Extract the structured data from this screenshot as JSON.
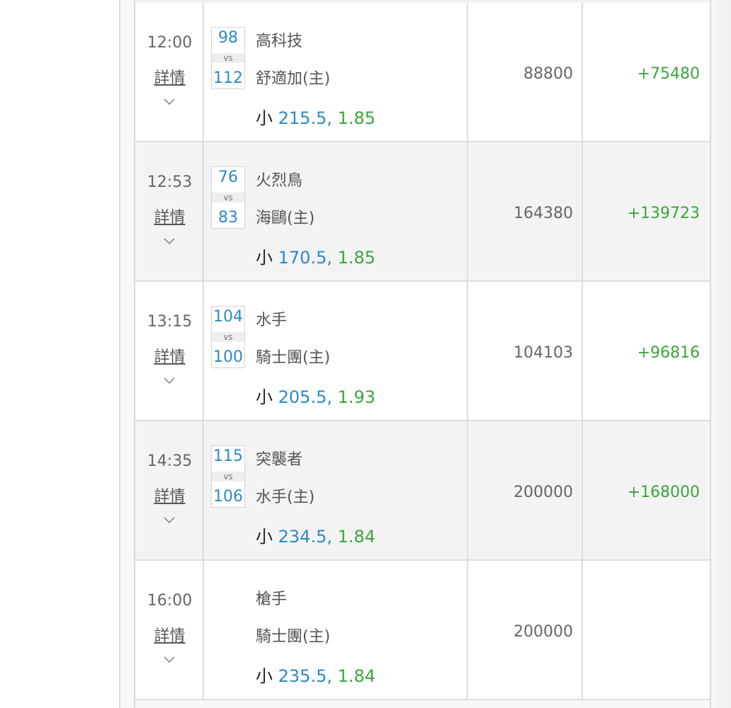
{
  "rows": [
    {
      "time": "12:00",
      "detail_label": "詳情",
      "score_away": "98",
      "vs": "vs",
      "score_home": "112",
      "team_away": "高科技",
      "team_home": "舒適加(主)",
      "bet_side": "小",
      "bet_line": "215.5,",
      "bet_price": "1.85",
      "amount": "88800",
      "result": "+75480"
    },
    {
      "time": "12:53",
      "detail_label": "詳情",
      "score_away": "76",
      "vs": "vs",
      "score_home": "83",
      "team_away": "火烈鳥",
      "team_home": "海鷗(主)",
      "bet_side": "小",
      "bet_line": "170.5,",
      "bet_price": "1.85",
      "amount": "164380",
      "result": "+139723"
    },
    {
      "time": "13:15",
      "detail_label": "詳情",
      "score_away": "104",
      "vs": "vs",
      "score_home": "100",
      "team_away": "水手",
      "team_home": "騎士團(主)",
      "bet_side": "小",
      "bet_line": "205.5,",
      "bet_price": "1.93",
      "amount": "104103",
      "result": "+96816"
    },
    {
      "time": "14:35",
      "detail_label": "詳情",
      "score_away": "115",
      "vs": "vs",
      "score_home": "106",
      "team_away": "突襲者",
      "team_home": "水手(主)",
      "bet_side": "小",
      "bet_line": "234.5,",
      "bet_price": "1.84",
      "amount": "200000",
      "result": "+168000"
    },
    {
      "time": "16:00",
      "detail_label": "詳情",
      "team_away": "槍手",
      "team_home": "騎士團(主)",
      "bet_side": "小",
      "bet_line": "235.5,",
      "bet_price": "1.84",
      "amount": "200000",
      "result": ""
    }
  ],
  "colors": {
    "score_blue": "#2a8ac8",
    "win_green": "#3aa63a",
    "text_gray": "#666666"
  },
  "icons": {
    "expand": "chevron-down-icon"
  }
}
